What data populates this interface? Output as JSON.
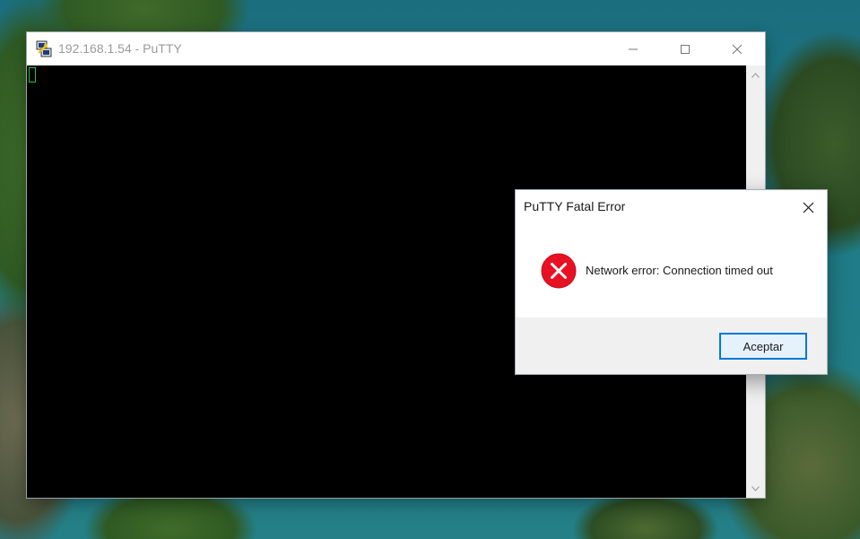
{
  "putty_window": {
    "title": "192.168.1.54 - PuTTY",
    "icon": "putty-app-icon",
    "controls": [
      "minimize-icon",
      "maximize-icon",
      "close-icon"
    ]
  },
  "terminal": {
    "background": "#000000",
    "cursor_color": "#22c23a"
  },
  "error_dialog": {
    "title": "PuTTY Fatal Error",
    "message": "Network error: Connection timed out",
    "icon": "error-icon",
    "ok_label": "Aceptar",
    "accent": "#0078d7",
    "error_color": "#e81123"
  }
}
